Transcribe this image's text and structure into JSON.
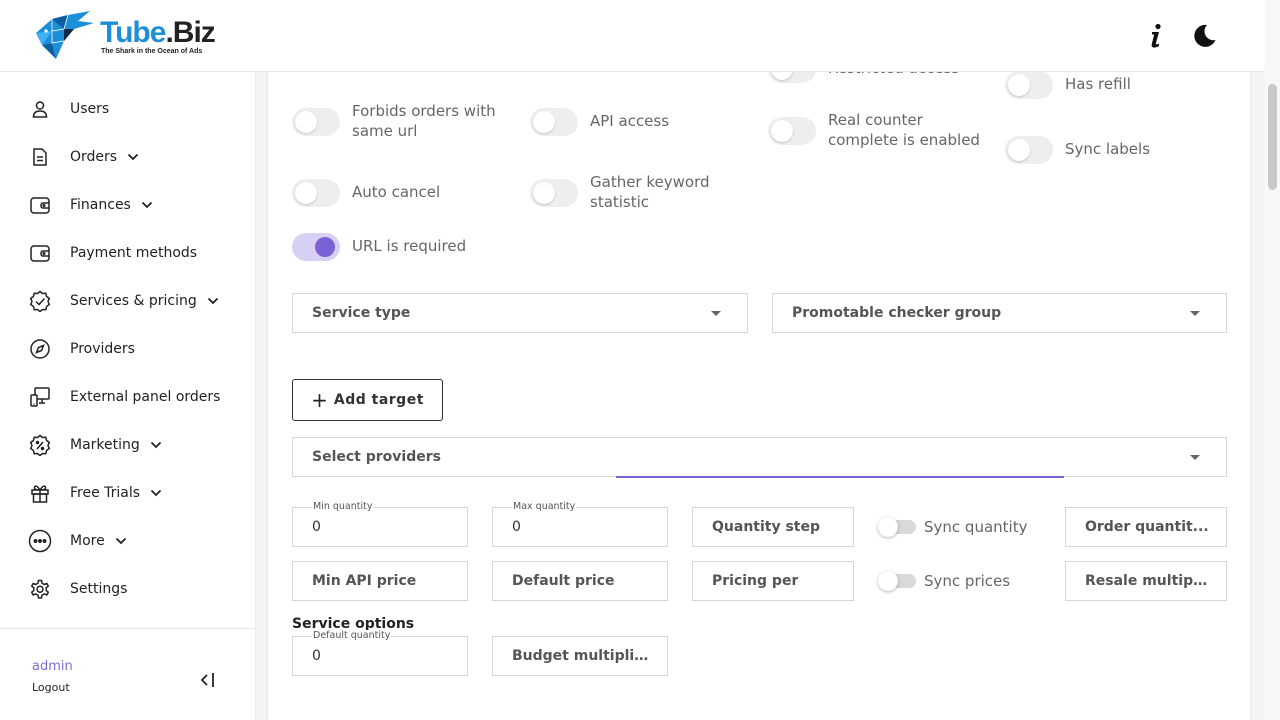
{
  "brand": {
    "name_part1": "Tube",
    "name_part2": ".Biz",
    "tagline": "The Shark in the Ocean of Ads",
    "accent_color": "#1d8fd8"
  },
  "header": {
    "info_icon": "info-icon",
    "theme_icon": "moon-icon"
  },
  "sidebar": {
    "items": [
      {
        "label": "Users",
        "icon": "user-icon"
      },
      {
        "label": "Orders",
        "icon": "document-icon"
      },
      {
        "label": "Finances",
        "icon": "wallet-icon"
      },
      {
        "label": "Payment methods",
        "icon": "wallet-icon"
      },
      {
        "label": "Services & pricing",
        "icon": "badge-check-icon"
      },
      {
        "label": "Providers",
        "icon": "compass-icon"
      },
      {
        "label": "External panel orders",
        "icon": "devices-icon"
      },
      {
        "label": "Marketing",
        "icon": "discount-icon"
      },
      {
        "label": "Free Trials",
        "icon": "gift-icon"
      },
      {
        "label": "More",
        "icon": "more-icon"
      },
      {
        "label": "Settings",
        "icon": "gear-icon"
      }
    ],
    "user": "admin",
    "logout": "Logout"
  },
  "toggles": {
    "restricted_access": "Restricted access",
    "has_refill": "Has refill",
    "forbids_orders": "Forbids orders with same url",
    "api_access": "API access",
    "real_counter": "Real counter complete is enabled",
    "sync_labels": "Sync labels",
    "auto_cancel": "Auto cancel",
    "gather_keyword": "Gather keyword statistic",
    "url_required": "URL is required",
    "url_required_on": true
  },
  "selects": {
    "service_type": "Service type",
    "promotable_checker": "Promotable checker group",
    "select_providers": "Select providers"
  },
  "buttons": {
    "add_target": "Add target"
  },
  "fields": {
    "min_quantity_label": "Min quantity",
    "min_quantity_value": "0",
    "max_quantity_label": "Max quantity",
    "max_quantity_value": "0",
    "quantity_step": "Quantity step",
    "sync_quantity": "Sync quantity",
    "order_quantity": "Order quantit...",
    "min_api_price": "Min API price",
    "default_price": "Default price",
    "pricing_per": "Pricing per",
    "sync_prices": "Sync prices",
    "resale_multiplier": "Resale multipli...",
    "default_quantity_label": "Default quantity",
    "default_quantity_value": "0",
    "budget_multiplier": "Budget multipli..."
  },
  "section": {
    "service_options": "Service options"
  }
}
